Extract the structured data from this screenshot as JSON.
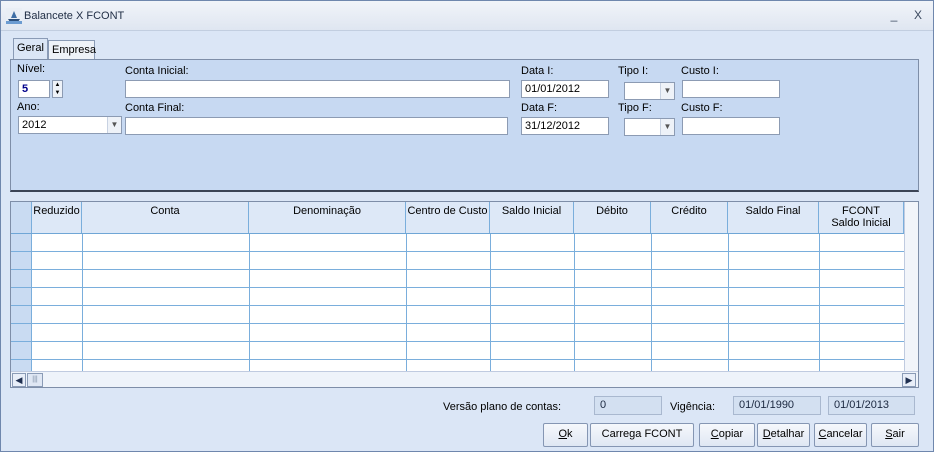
{
  "window": {
    "title": "Balancete X FCONT",
    "minimize_glyph": "_",
    "close_glyph": "X",
    "app_icon": "ship-icon"
  },
  "tabs": [
    {
      "label": "Geral",
      "active": true
    },
    {
      "label": "Empresa",
      "active": false
    }
  ],
  "filters": {
    "nivel_label": "Nível:",
    "nivel_value": "5",
    "ano_label": "Ano:",
    "ano_value": "2012",
    "conta_inicial_label": "Conta Inicial:",
    "conta_inicial_value": "",
    "conta_final_label": "Conta Final:",
    "conta_final_value": "",
    "data_i_label": "Data I:",
    "data_i_value": "01/01/2012",
    "data_f_label": "Data F:",
    "data_f_value": "31/12/2012",
    "tipo_i_label": "Tipo I:",
    "tipo_i_value": "",
    "tipo_f_label": "Tipo F:",
    "tipo_f_value": "",
    "custo_i_label": "Custo I:",
    "custo_i_value": "",
    "custo_f_label": "Custo F:",
    "custo_f_value": ""
  },
  "grid": {
    "columns": [
      {
        "line1": "Reduzido",
        "line2": ""
      },
      {
        "line1": "Conta",
        "line2": ""
      },
      {
        "line1": "Denominação",
        "line2": ""
      },
      {
        "line1": "Centro de Custo",
        "line2": ""
      },
      {
        "line1": "Saldo Inicial",
        "line2": ""
      },
      {
        "line1": "Débito",
        "line2": ""
      },
      {
        "line1": "Crédito",
        "line2": ""
      },
      {
        "line1": "Saldo Final",
        "line2": ""
      },
      {
        "line1": "FCONT",
        "line2": "Saldo Inicial"
      }
    ],
    "rows": []
  },
  "footer": {
    "versao_label": "Versão plano de contas:",
    "versao_value": "0",
    "vigencia_label": "Vigência:",
    "vigencia_inicio": "01/01/1990",
    "vigencia_fim": "01/01/2013"
  },
  "buttons": {
    "ok_u": "O",
    "ok_rest": "k",
    "carrega": "Carrega FCONT",
    "copiar_u": "C",
    "copiar_rest": "opiar",
    "detalhar_u": "D",
    "detalhar_rest": "etalhar",
    "cancelar_u": "C",
    "cancelar_rest": "ancelar",
    "sair_u": "S",
    "sair_rest": "air"
  }
}
